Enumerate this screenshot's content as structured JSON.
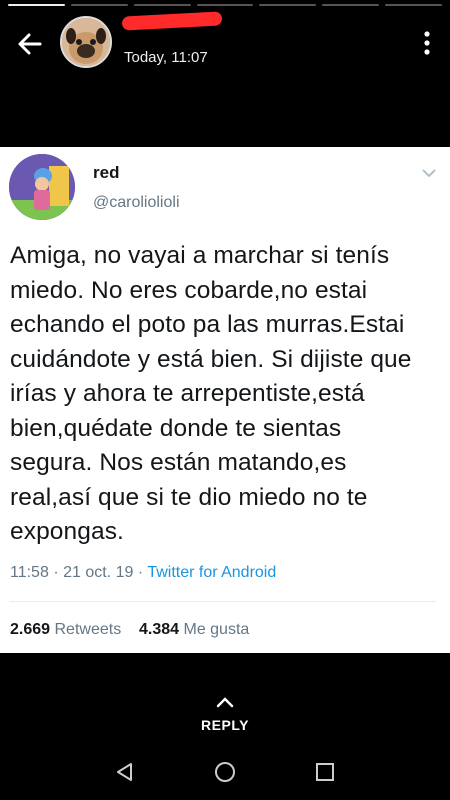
{
  "story": {
    "time": "Today, 11:07",
    "progress": [
      1,
      0,
      0,
      0,
      0,
      0,
      0
    ]
  },
  "tweet": {
    "name": "red",
    "handle": "@caroliolioli",
    "text": "Amiga, no vayai a marchar si tenís miedo. No eres cobarde,no estai echando el poto pa las murras.Estai cuidándote y está bien. Si dijiste que irías y ahora te arrepentiste,está bien,quédate donde te sientas segura. Nos están matando,es real,así que si te dio miedo no te expongas.",
    "time": "11:58",
    "date": "21 oct. 19",
    "source": "Twitter for Android",
    "retweets_count": "2.669",
    "retweets_label": "Retweets",
    "likes_count": "4.384",
    "likes_label": "Me gusta"
  },
  "reply": {
    "label": "REPLY"
  },
  "icons": {
    "back": "arrow-left-icon",
    "menu": "more-vertical-icon",
    "nav_back": "triangle-back-icon",
    "nav_home": "circle-home-icon",
    "nav_recents": "square-recents-icon"
  },
  "colors": {
    "background": "#000000",
    "card": "#ffffff",
    "link": "#1b95e0",
    "secondary_text": "#657786",
    "redaction": "#ff2a2a"
  }
}
